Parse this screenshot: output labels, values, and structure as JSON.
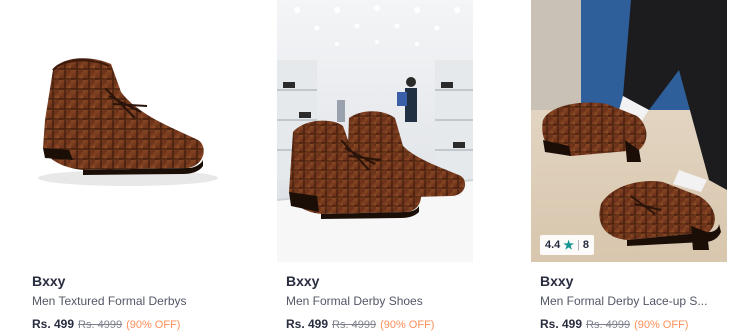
{
  "products": [
    {
      "brand": "Bxxy",
      "name": "Men Textured Formal Derbys",
      "price": "Rs. 499",
      "mrp": "Rs. 4999",
      "discount": "(90% OFF)"
    },
    {
      "brand": "Bxxy",
      "name": "Men Formal Derby Shoes",
      "price": "Rs. 499",
      "mrp": "Rs. 4999",
      "discount": "(90% OFF)"
    },
    {
      "brand": "Bxxy",
      "name": "Men Formal Derby Lace-up S...",
      "price": "Rs. 499",
      "mrp": "Rs. 4999",
      "discount": "(90% OFF)",
      "rating": "4.4",
      "rating_count": "8"
    }
  ],
  "colors": {
    "discount": "#ff905a",
    "star": "#14958f",
    "shoe_brown": "#7a3e1f"
  }
}
